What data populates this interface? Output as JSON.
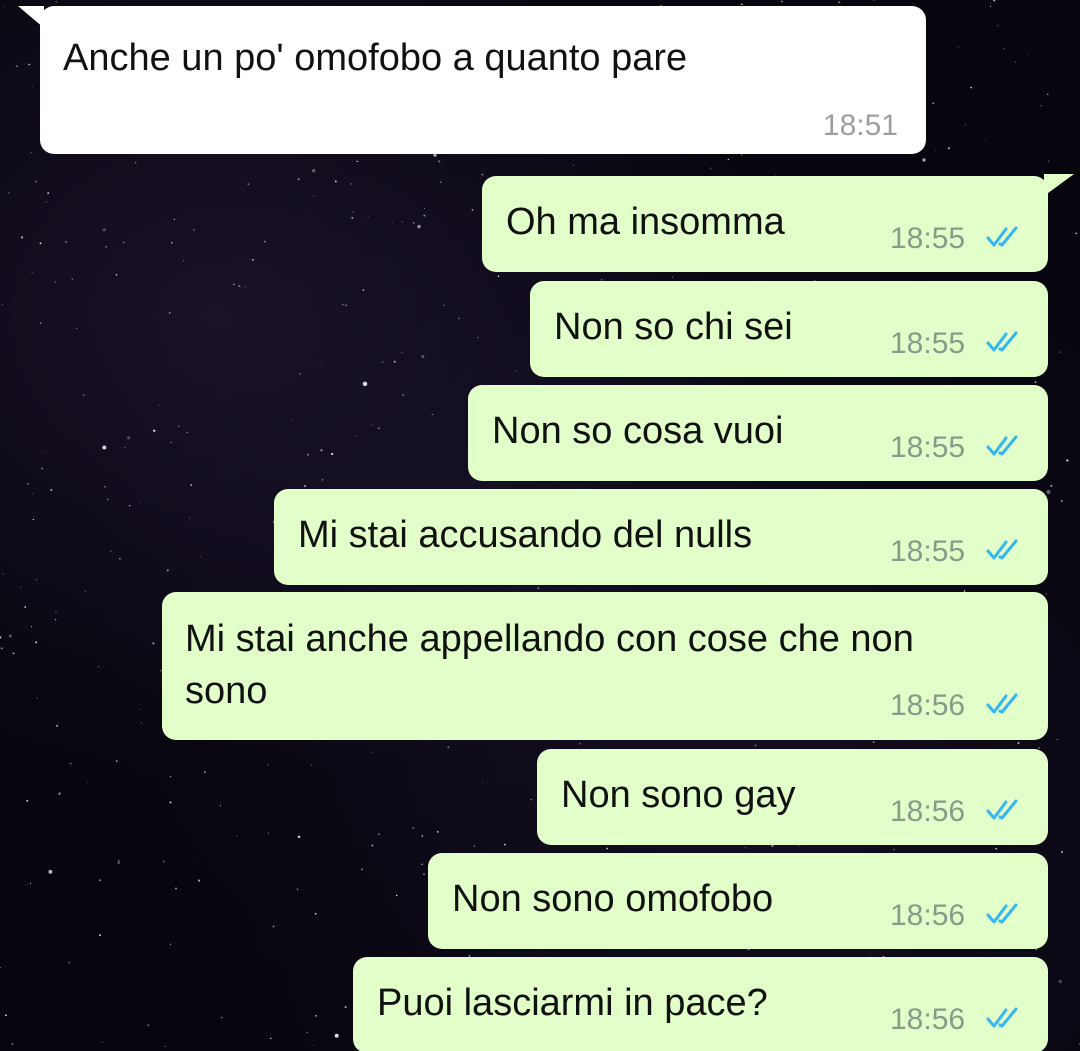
{
  "colors": {
    "incoming_bubble": "#ffffff",
    "outgoing_bubble": "#e2fec9",
    "read_ticks": "#34b7f1",
    "timestamp": "#8a9a8a"
  },
  "messages": [
    {
      "direction": "incoming",
      "text": "Anche un po' omofobo a quanto pare",
      "time": "18:51"
    },
    {
      "direction": "outgoing",
      "text": "Oh ma insomma",
      "time": "18:55",
      "status": "read",
      "status_icon": "double-check-icon"
    },
    {
      "direction": "outgoing",
      "text": "Non so chi sei",
      "time": "18:55",
      "status": "read",
      "status_icon": "double-check-icon"
    },
    {
      "direction": "outgoing",
      "text": "Non so cosa vuoi",
      "time": "18:55",
      "status": "read",
      "status_icon": "double-check-icon"
    },
    {
      "direction": "outgoing",
      "text": "Mi stai accusando del nulls",
      "time": "18:55",
      "status": "read",
      "status_icon": "double-check-icon"
    },
    {
      "direction": "outgoing",
      "text_line1": "Mi stai anche appellando con cose che non",
      "text_line2": "sono",
      "time": "18:56",
      "status": "read",
      "status_icon": "double-check-icon"
    },
    {
      "direction": "outgoing",
      "text": "Non sono gay",
      "time": "18:56",
      "status": "read",
      "status_icon": "double-check-icon"
    },
    {
      "direction": "outgoing",
      "text": "Non sono omofobo",
      "time": "18:56",
      "status": "read",
      "status_icon": "double-check-icon"
    },
    {
      "direction": "outgoing",
      "text": "Puoi lasciarmi in pace?",
      "time": "18:56",
      "status": "read",
      "status_icon": "double-check-icon"
    }
  ]
}
